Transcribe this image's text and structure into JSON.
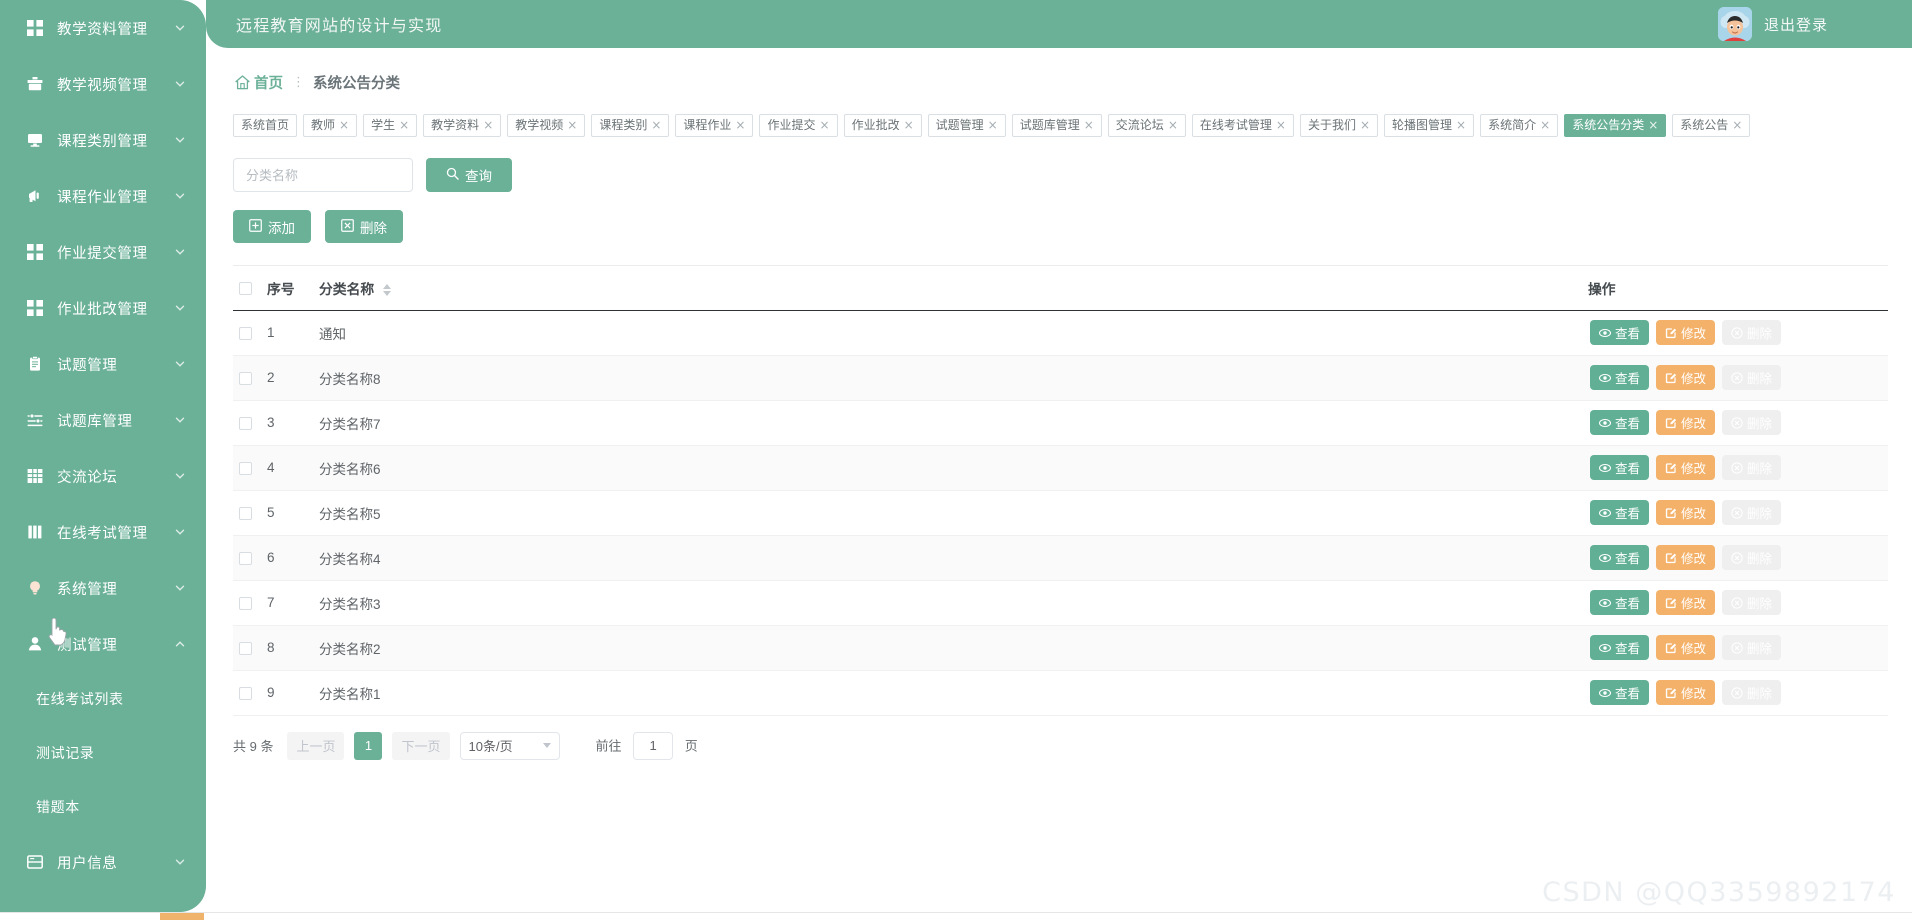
{
  "colors": {
    "brand_green": "#6bb198",
    "action_view": "#61b096",
    "action_edit": "#f4b169",
    "action_delete": "#f2788a",
    "text_dark": "#464b4f",
    "text_muted": "#5f6468"
  },
  "header": {
    "app_title": "远程教育网站的设计与实现",
    "logout_label": "退出登录",
    "avatar_icon": "user-avatar"
  },
  "sidebar": {
    "items": [
      {
        "label": "教学资料管理",
        "icon": "grid-icon",
        "arrow": "chevron-down-icon",
        "expanded": false
      },
      {
        "label": "教学视频管理",
        "icon": "briefcase-icon",
        "arrow": "chevron-down-icon",
        "expanded": false
      },
      {
        "label": "课程类别管理",
        "icon": "monitor-icon",
        "arrow": "chevron-down-icon",
        "expanded": false
      },
      {
        "label": "课程作业管理",
        "icon": "megaphone-icon",
        "arrow": "chevron-down-icon",
        "expanded": false
      },
      {
        "label": "作业提交管理",
        "icon": "grid-icon",
        "arrow": "chevron-down-icon",
        "expanded": false
      },
      {
        "label": "作业批改管理",
        "icon": "grid-icon",
        "arrow": "chevron-down-icon",
        "expanded": false
      },
      {
        "label": "试题管理",
        "icon": "clipboard-icon",
        "arrow": "chevron-down-icon",
        "expanded": false
      },
      {
        "label": "试题库管理",
        "icon": "sliders-icon",
        "arrow": "chevron-down-icon",
        "expanded": false
      },
      {
        "label": "交流论坛",
        "icon": "table-icon",
        "arrow": "chevron-down-icon",
        "expanded": false
      },
      {
        "label": "在线考试管理",
        "icon": "book-icon",
        "arrow": "chevron-down-icon",
        "expanded": false
      },
      {
        "label": "系统管理",
        "icon": "bulb-icon",
        "arrow": "chevron-down-icon",
        "expanded": false
      },
      {
        "label": "测试管理",
        "icon": "user-icon",
        "arrow": "chevron-up-icon",
        "expanded": true
      }
    ],
    "submenu": [
      {
        "label": "在线考试列表"
      },
      {
        "label": "测试记录"
      },
      {
        "label": "错题本"
      }
    ],
    "trailing_items": [
      {
        "label": "用户信息",
        "icon": "id-card-icon",
        "arrow": "chevron-down-icon",
        "expanded": false
      }
    ]
  },
  "breadcrumb": {
    "home_label": "首页",
    "home_icon": "home-icon",
    "separator": "⋮",
    "current": "系统公告分类"
  },
  "tabs": [
    {
      "label": "系统首页",
      "closable": false,
      "active": false
    },
    {
      "label": "教师",
      "closable": true,
      "active": false
    },
    {
      "label": "学生",
      "closable": true,
      "active": false
    },
    {
      "label": "教学资料",
      "closable": true,
      "active": false
    },
    {
      "label": "教学视频",
      "closable": true,
      "active": false
    },
    {
      "label": "课程类别",
      "closable": true,
      "active": false
    },
    {
      "label": "课程作业",
      "closable": true,
      "active": false
    },
    {
      "label": "作业提交",
      "closable": true,
      "active": false
    },
    {
      "label": "作业批改",
      "closable": true,
      "active": false
    },
    {
      "label": "试题管理",
      "closable": true,
      "active": false
    },
    {
      "label": "试题库管理",
      "closable": true,
      "active": false
    },
    {
      "label": "交流论坛",
      "closable": true,
      "active": false
    },
    {
      "label": "在线考试管理",
      "closable": true,
      "active": false
    },
    {
      "label": "关于我们",
      "closable": true,
      "active": false
    },
    {
      "label": "轮播图管理",
      "closable": true,
      "active": false
    },
    {
      "label": "系统简介",
      "closable": true,
      "active": false
    },
    {
      "label": "系统公告分类",
      "closable": true,
      "active": true
    },
    {
      "label": "系统公告",
      "closable": true,
      "active": false
    }
  ],
  "search": {
    "placeholder": "分类名称",
    "value": "",
    "button_label": "查询",
    "button_icon": "search-icon"
  },
  "actions": [
    {
      "label": "添加",
      "icon": "plus-square-icon"
    },
    {
      "label": "删除",
      "icon": "x-square-icon"
    }
  ],
  "table": {
    "columns": {
      "index": "序号",
      "name": "分类名称",
      "ops": "操作"
    },
    "sortable_column": "分类名称",
    "row_ops": [
      {
        "label": "查看",
        "icon": "eye-icon",
        "style": "view"
      },
      {
        "label": "修改",
        "icon": "edit-square-icon",
        "style": "edit"
      },
      {
        "label": "删除",
        "icon": "circle-close-icon",
        "style": "delete"
      }
    ],
    "rows": [
      {
        "index": "1",
        "name": "通知"
      },
      {
        "index": "2",
        "name": "分类名称8"
      },
      {
        "index": "3",
        "name": "分类名称7"
      },
      {
        "index": "4",
        "name": "分类名称6"
      },
      {
        "index": "5",
        "name": "分类名称5"
      },
      {
        "index": "6",
        "name": "分类名称4"
      },
      {
        "index": "7",
        "name": "分类名称3"
      },
      {
        "index": "8",
        "name": "分类名称2"
      },
      {
        "index": "9",
        "name": "分类名称1"
      }
    ]
  },
  "pagination": {
    "total_label": "共 9 条",
    "prev_label": "上一页",
    "current_page": "1",
    "next_label": "下一页",
    "page_size_label": "10条/页",
    "goto_prefix": "前往",
    "goto_value": "1",
    "goto_suffix": "页"
  },
  "watermark": "CSDN @QQ3359892174"
}
